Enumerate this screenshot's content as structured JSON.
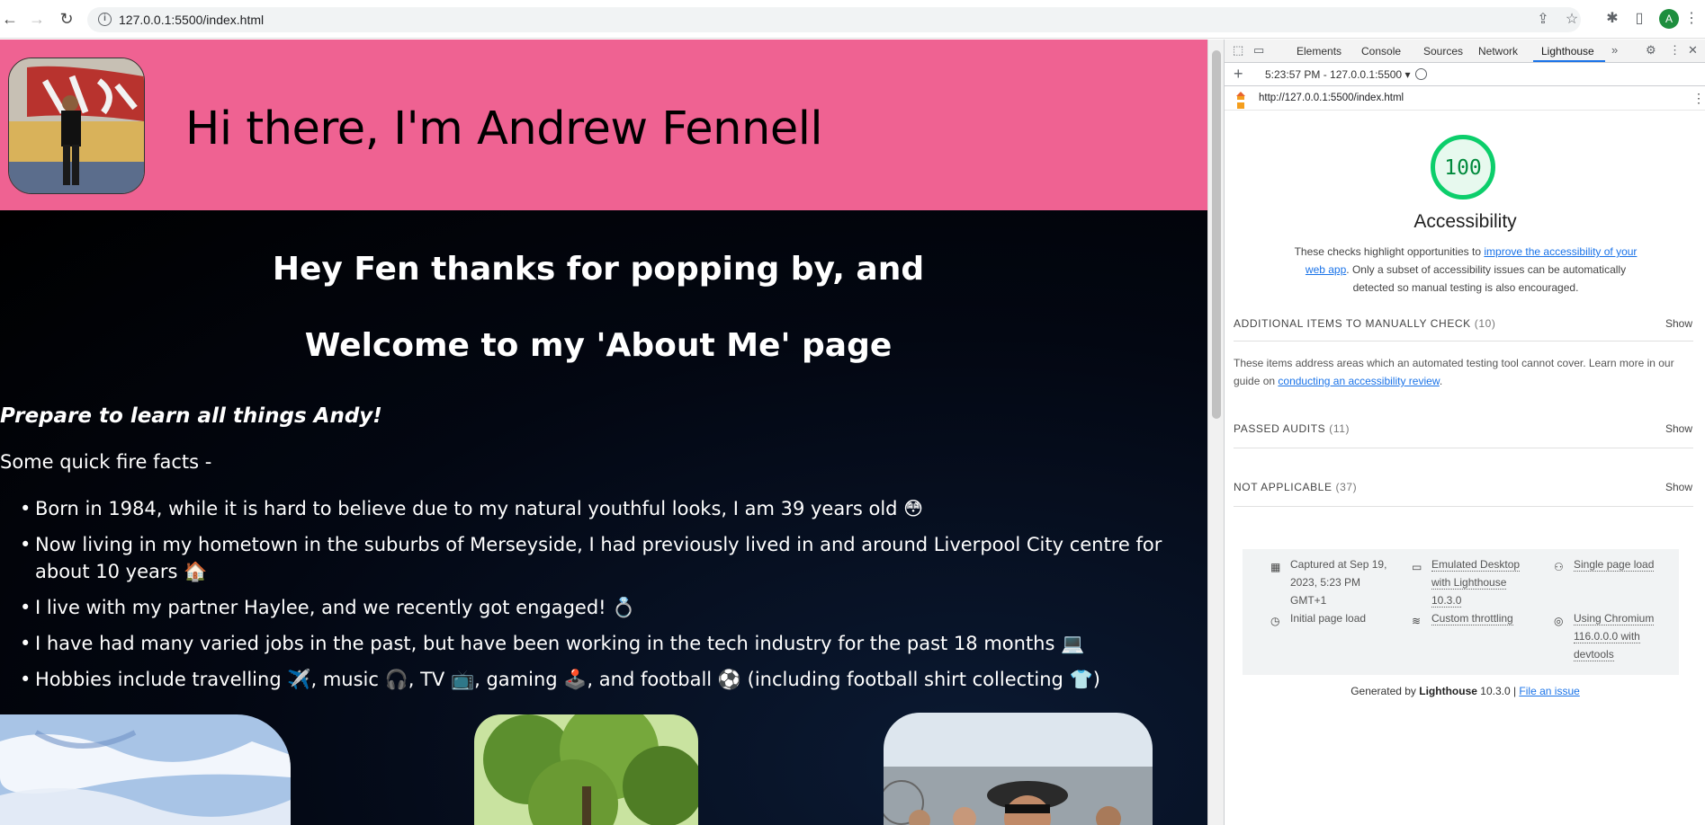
{
  "browser": {
    "url": "127.0.0.1:5500/index.html",
    "avatar_letter": "A"
  },
  "page": {
    "header_title": "Hi there, I'm Andrew Fennell",
    "welcome_line1": "Hey Fen thanks for popping by, and",
    "welcome_line2": "Welcome to my 'About Me' page",
    "prepare": "Prepare to learn all things Andy!",
    "facts_intro": "Some quick fire facts -",
    "facts": [
      "Born in 1984, while it is hard to believe due to my natural youthful looks, I am 39 years old 😳",
      "Now living in my hometown in the suburbs of Merseyside, I had previously lived in and around Liverpool City centre for about 10 years 🏠",
      "I live with my partner Haylee, and we recently got engaged! 💍",
      "I have had many varied jobs in the past, but have been working in the tech industry for the past 18 months 💻",
      "Hobbies include travelling ✈️, music 🎧, TV 📺, gaming 🕹️, and football ⚽ (including football shirt collecting 👕)"
    ],
    "colors": {
      "hero": "#ef6292",
      "background": "#000000"
    }
  },
  "devtools": {
    "tabs": [
      "Elements",
      "Console",
      "Sources",
      "Network",
      "Lighthouse"
    ],
    "active_tab": "Lighthouse",
    "report_label": "5:23:57 PM - 127.0.0.1:5500",
    "report_url": "http://127.0.0.1:5500/index.html",
    "score": "100",
    "category": "Accessibility",
    "desc_before": "These checks highlight opportunities to ",
    "desc_link": "improve the accessibility of your web app",
    "desc_after": ". Only a subset of accessibility issues can be automatically detected so manual testing is also encouraged.",
    "sections": {
      "manual": {
        "title": "ADDITIONAL ITEMS TO MANUALLY CHECK",
        "count": "(10)",
        "show": "Show"
      },
      "passed": {
        "title": "PASSED AUDITS",
        "count": "(11)",
        "show": "Show"
      },
      "na": {
        "title": "NOT APPLICABLE",
        "count": "(37)",
        "show": "Show"
      }
    },
    "manual_desc_before": "These items address areas which an automated testing tool cannot cover. Learn more in our guide on ",
    "manual_desc_link": "conducting an accessibility review",
    "manual_desc_after": ".",
    "env": {
      "captured": "Captured at Sep 19, 2023, 5:23 PM GMT+1",
      "emulated": "Emulated Desktop with Lighthouse 10.3.0",
      "single": "Single page load",
      "initial": "Initial page load",
      "throttling": "Custom throttling",
      "chromium": "Using Chromium 116.0.0.0 with devtools"
    },
    "generated_prefix": "Generated by ",
    "generated_brand": "Lighthouse",
    "generated_version": " 10.3.0 | ",
    "file_issue": "File an issue",
    "score_color": "#0cce6b"
  }
}
